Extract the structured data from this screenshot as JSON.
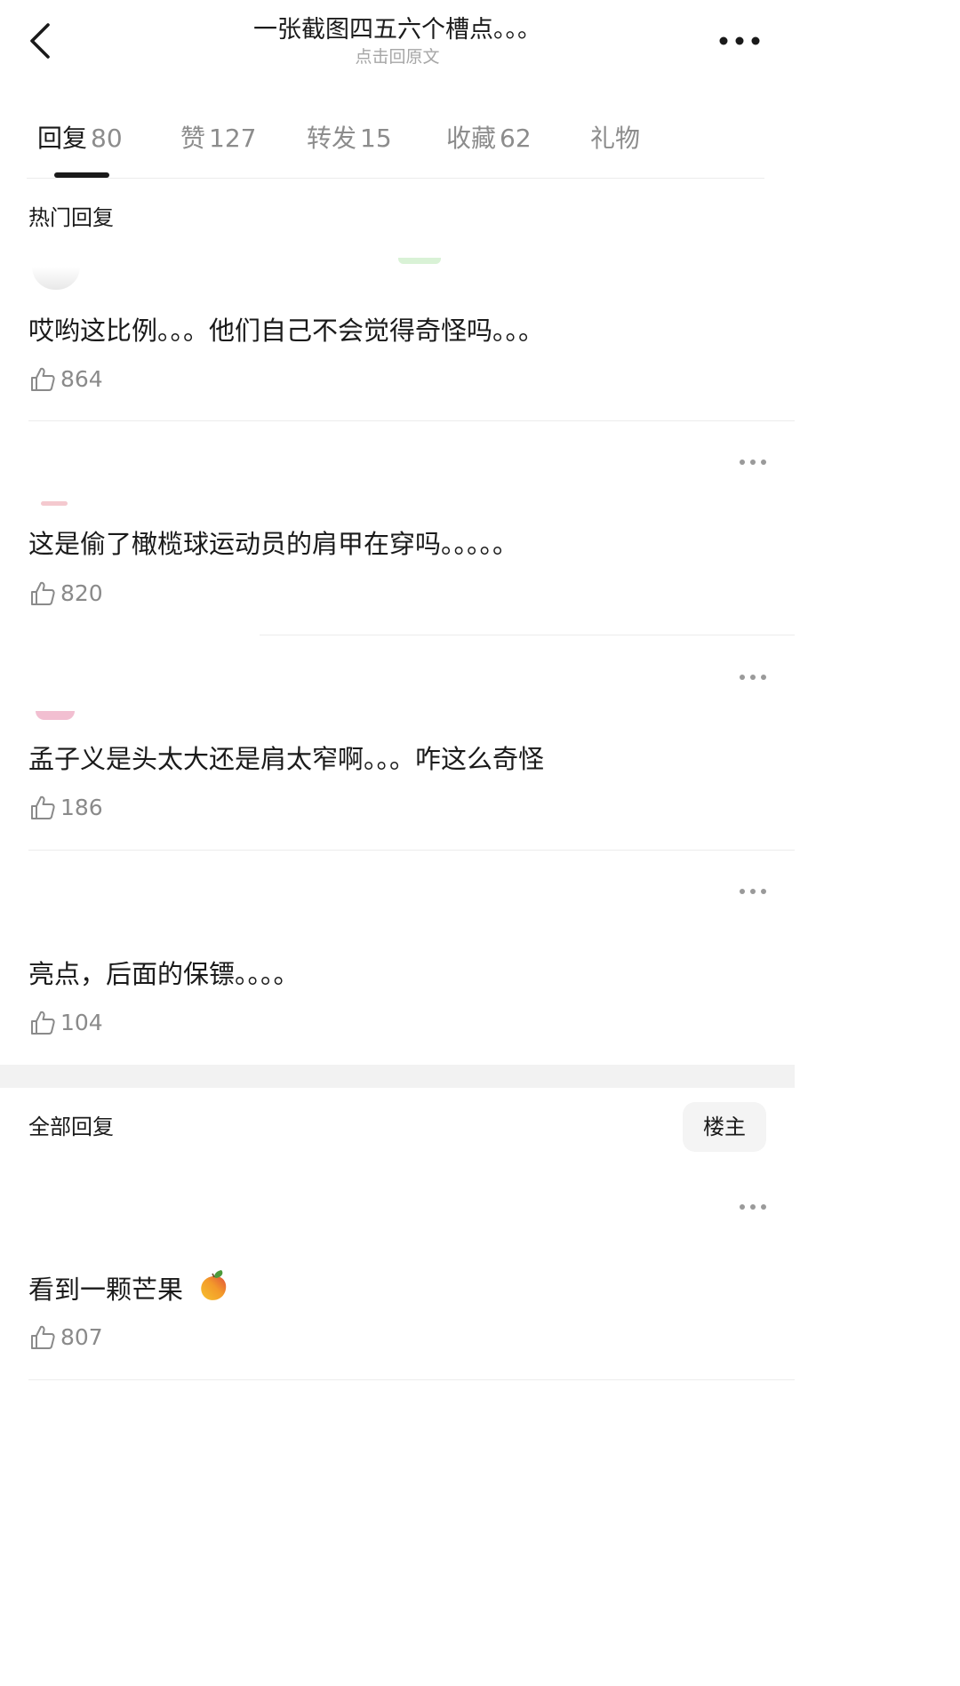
{
  "header": {
    "title": "一张截图四五六个槽点。。。",
    "subtitle": "点击回原文"
  },
  "tabs": [
    {
      "label": "回复",
      "count": "80"
    },
    {
      "label": "赞",
      "count": "127"
    },
    {
      "label": "转发",
      "count": "15"
    },
    {
      "label": "收藏",
      "count": "62"
    },
    {
      "label": "礼物",
      "count": ""
    }
  ],
  "hot_section": {
    "title": "热门回复",
    "comments": [
      {
        "text": "哎哟这比例。。。他们自己不会觉得奇怪吗。。。",
        "likes": "864"
      },
      {
        "text": "这是偷了橄榄球运动员的肩甲在穿吗。。。。。",
        "likes": "820"
      },
      {
        "text": "孟子义是头太大还是肩太窄啊。。。咋这么奇怪",
        "likes": "186"
      },
      {
        "text": "亮点，后面的保镖。。。。",
        "likes": "104"
      }
    ]
  },
  "all_section": {
    "title": "全部回复",
    "filter_button": "楼主",
    "comments": [
      {
        "text": "看到一颗芒果",
        "likes": "807",
        "emoji": "🥭"
      }
    ]
  },
  "colors": {
    "text": "#1a1a1a",
    "muted": "#8a8a8a",
    "divider": "#ececec"
  }
}
